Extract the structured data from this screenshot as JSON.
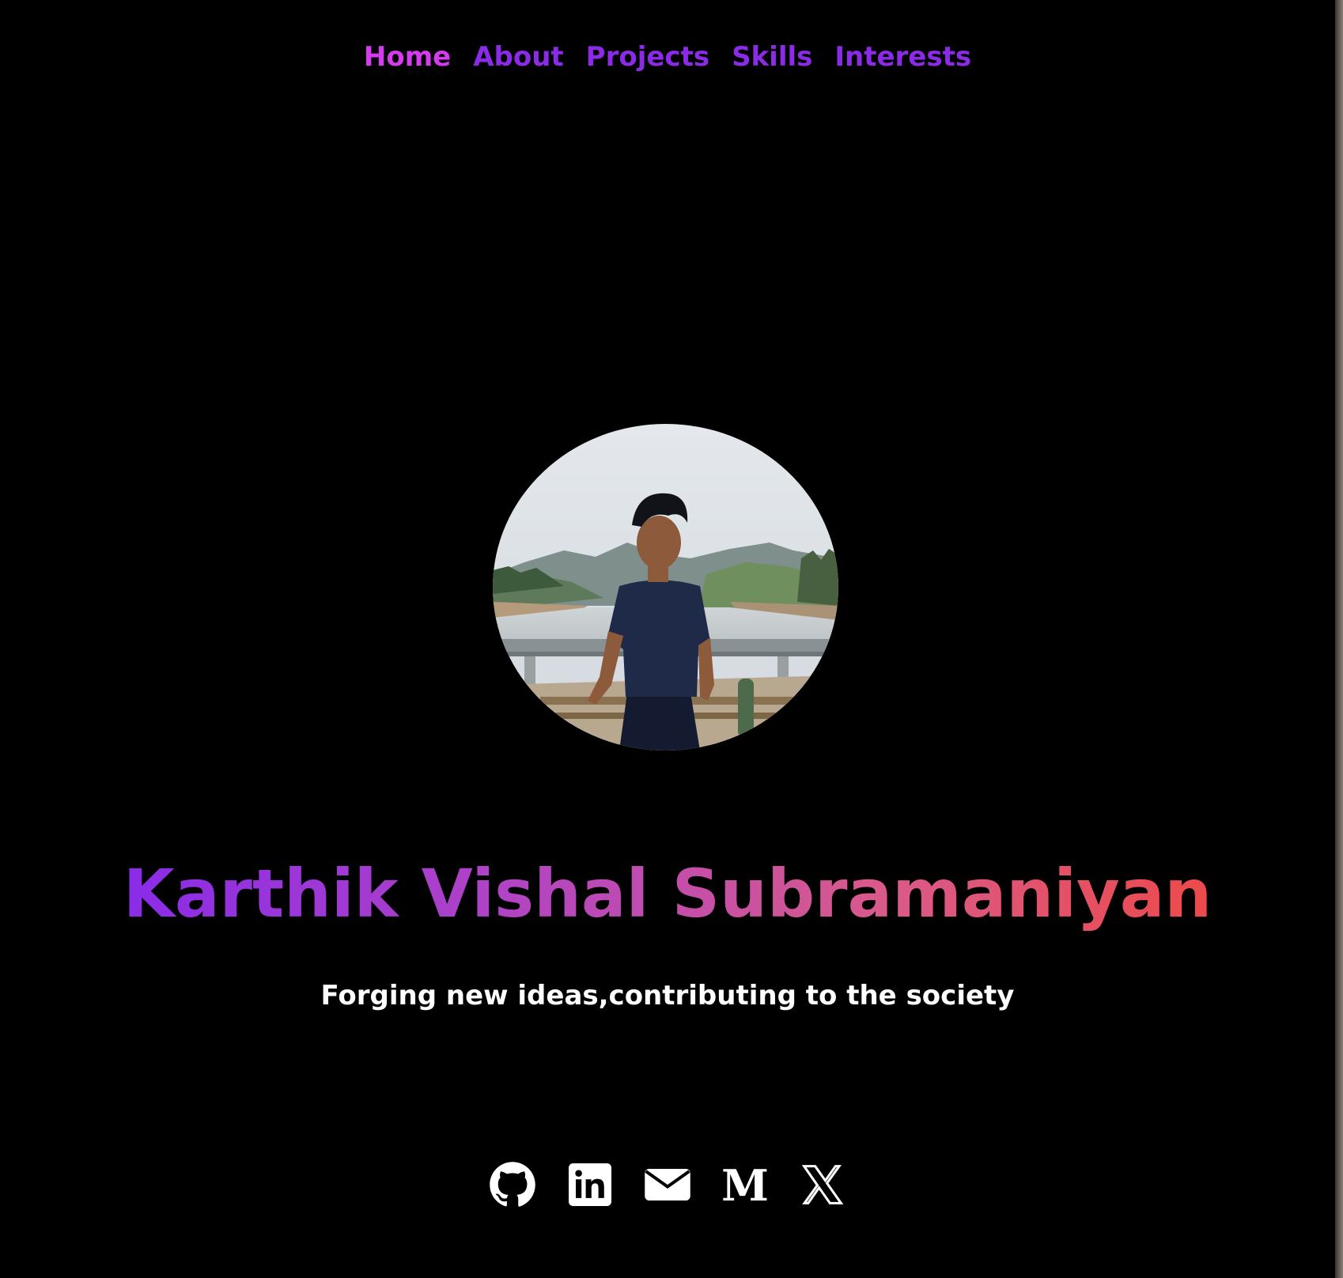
{
  "nav": {
    "items": [
      {
        "label": "Home",
        "active": true
      },
      {
        "label": "About",
        "active": false
      },
      {
        "label": "Projects",
        "active": false
      },
      {
        "label": "Skills",
        "active": false
      },
      {
        "label": "Interests",
        "active": false
      }
    ]
  },
  "hero": {
    "name": "Karthik Vishal Subramaniyan",
    "tagline": "Forging new ideas,contributing to the society"
  },
  "socials": [
    {
      "icon": "github-icon"
    },
    {
      "icon": "linkedin-icon"
    },
    {
      "icon": "mail-icon"
    },
    {
      "icon": "medium-icon"
    },
    {
      "icon": "x-icon"
    }
  ],
  "colors": {
    "background": "#000000",
    "nav_active": "#d63bf0",
    "nav_normal": "#8b2be8",
    "name_gradient_start": "#8a2be8",
    "name_gradient_end": "#ec4a4a",
    "tagline": "#ffffff",
    "icons": "#ffffff"
  }
}
